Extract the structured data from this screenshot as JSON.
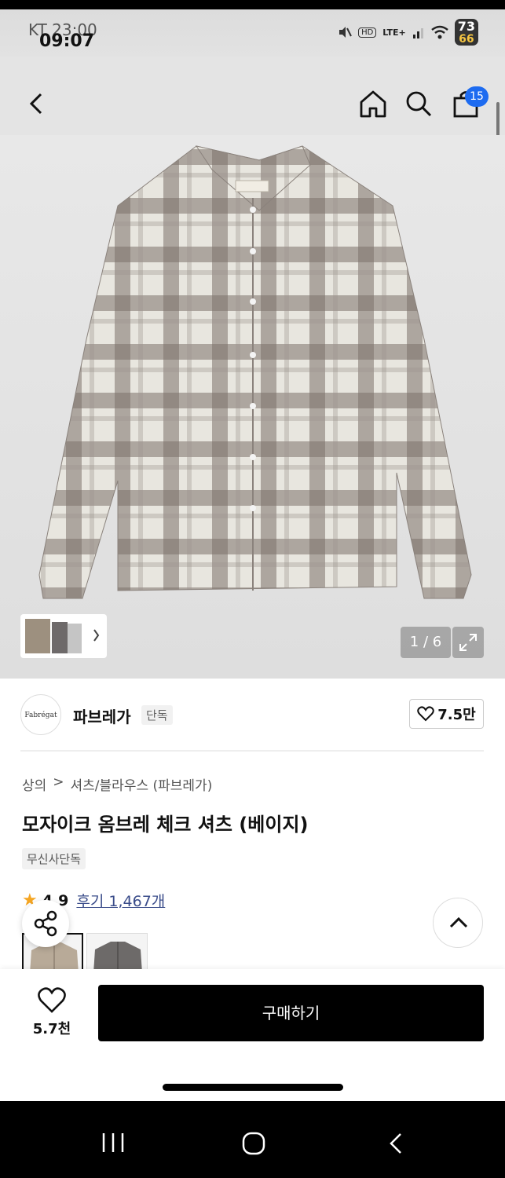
{
  "status_bar": {
    "carrier": "KT 23:00",
    "time": "09:07",
    "hd": "HD",
    "network": "LTE+",
    "battery_top": "73",
    "battery_bottom": "66"
  },
  "header": {
    "cart_count": "15"
  },
  "gallery": {
    "counter": "1 / 6"
  },
  "brand": {
    "logo_text": "Fabrégat",
    "name": "파브레가",
    "exclusive_tag": "단독",
    "likes": "7.5만"
  },
  "breadcrumb": {
    "level1": "상의",
    "separator": ">",
    "level2": "셔츠/블라우스 (파브레가)"
  },
  "product": {
    "title": "모자이크 옴브레 체크 셔츠 (베이지)",
    "tag": "무신사단독",
    "rating": "4.9",
    "reviews": "후기 1,467개"
  },
  "bottom_bar": {
    "wish_count": "5.7천",
    "buy_label": "구매하기"
  },
  "icons": {
    "back": "back-arrow-icon",
    "home": "home-icon",
    "search": "search-icon",
    "bag": "shopping-bag-icon",
    "share": "share-icon",
    "scroll_top": "chevron-up-icon",
    "heart": "heart-icon",
    "expand": "expand-icon"
  }
}
